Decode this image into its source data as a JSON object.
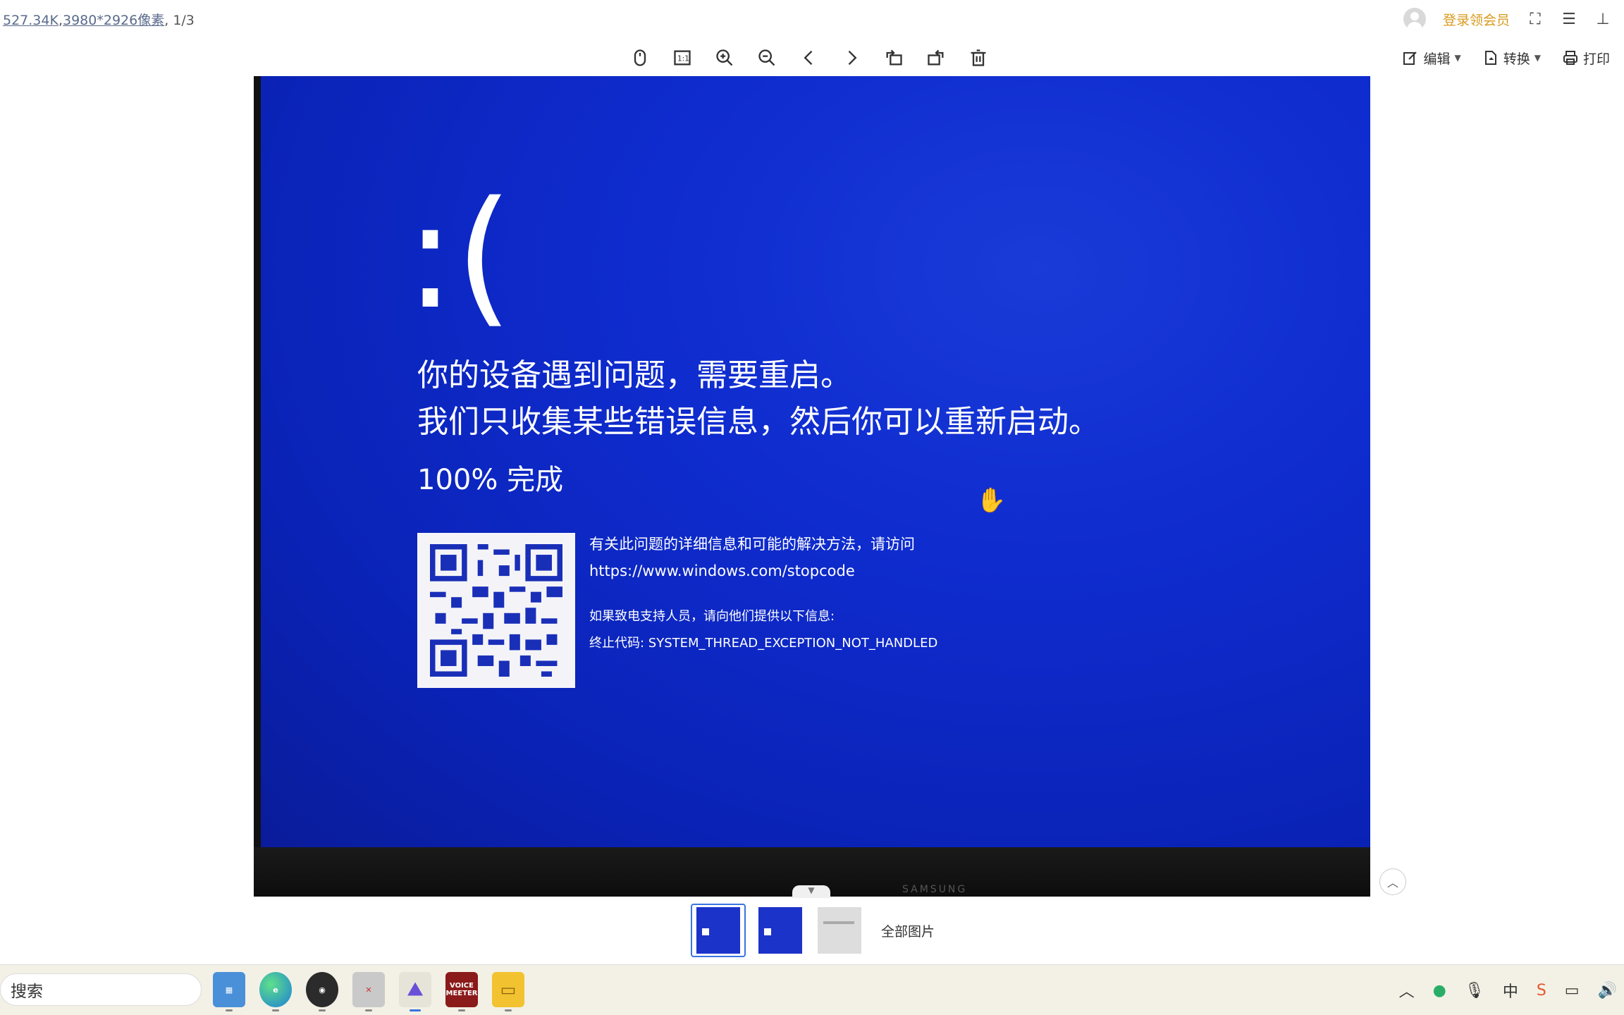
{
  "info": {
    "file_size": "527.34K",
    "dimensions": "3980*2926像素",
    "page": "1/3"
  },
  "topbar": {
    "member_label": "登录领会员"
  },
  "toolbar_right": {
    "edit_label": "编辑",
    "convert_label": "转换",
    "print_label": "打印"
  },
  "bsod": {
    "frown": ":(",
    "line1": "你的设备遇到问题，需要重启。",
    "line2": "我们只收集某些错误信息，然后你可以重新启动。",
    "progress": "100% 完成",
    "detail_intro": "有关此问题的详细信息和可能的解决方法，请访问",
    "detail_url": "https://www.windows.com/stopcode",
    "support_line": "如果致电支持人员，请向他们提供以下信息:",
    "stop_code": "终止代码: SYSTEM_THREAD_EXCEPTION_NOT_HANDLED",
    "brand": "SAMSUNG"
  },
  "thumbnails": {
    "all_label": "全部图片"
  },
  "taskbar": {
    "search_placeholder": "搜索",
    "voicemeeter_label_1": "VOICE",
    "voicemeeter_label_2": "MEETER"
  }
}
